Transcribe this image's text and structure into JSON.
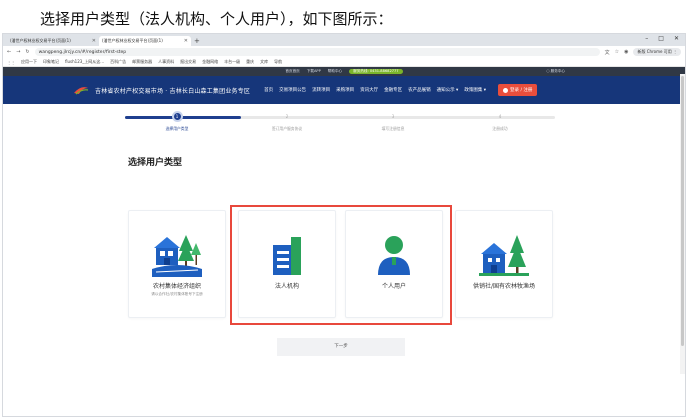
{
  "caption": "选择用户类型（法人机构、个人用户），如下图所示：",
  "browser": {
    "tabs": [
      {
        "label": "(潘世产权林业权交易平台)页面(1)",
        "active": false
      },
      {
        "label": "(潘世产权林业权交易平台)页面(1)",
        "active": true
      }
    ],
    "new_tab": "+",
    "url": "wangpeng.jlrcjy.cn/#/register/first-step",
    "chrome_account": "新版 Chrome 可用 ⋮",
    "bookmarks": [
      "应用一下",
      "印象笔记",
      "flush123_上网从这...",
      "百科广告",
      "邮票服务器",
      "人事资料",
      "报出交易",
      "金融网络",
      "丰台一级",
      "重庆",
      "文库",
      "导航"
    ],
    "window_controls": [
      "–",
      "□",
      "✕"
    ]
  },
  "site": {
    "top_links": [
      "首页首页",
      "下载APP",
      "帮助中心"
    ],
    "hotline": "服务热线: 0431-88682777",
    "top_right": "○ 服务中心",
    "title": "吉林省农村产权交易市场 · 吉林长白山森工集团业务专区",
    "nav": [
      "首页",
      "交易项目公告",
      "流转项目",
      "采购项目",
      "资讯大厅",
      "金融专区",
      "农产品展销",
      "通知公示 ▾",
      "政策图集 ▾"
    ],
    "login": "登录 / 注册"
  },
  "steps": [
    {
      "num": "1",
      "label": "选择用户类型",
      "active": true
    },
    {
      "num": "2",
      "label": "签订用户服务协议",
      "active": false
    },
    {
      "num": "3",
      "label": "填写注册信息",
      "active": false
    },
    {
      "num": "4",
      "label": "注册成功",
      "active": false
    }
  ],
  "progress_fraction": 0.27,
  "section_title": "选择用户类型",
  "cards": [
    {
      "name": "农村集体经济组织",
      "desc": "请以合作社/农村集体账号下注册",
      "icon": "rural-collective-icon"
    },
    {
      "name": "法人机构",
      "desc": "",
      "icon": "corporate-building-icon"
    },
    {
      "name": "个人用户",
      "desc": "",
      "icon": "person-icon"
    },
    {
      "name": "供销社/国有农林牧渔场",
      "desc": "",
      "icon": "forest-farm-icon"
    }
  ],
  "next_button": "下一步",
  "colors": {
    "header": "#16367a",
    "accent": "#1f3f8f",
    "login": "#e94e3c",
    "highlight": "#e8483c",
    "icon_blue": "#1e5fbf",
    "icon_green": "#2aa25a"
  }
}
